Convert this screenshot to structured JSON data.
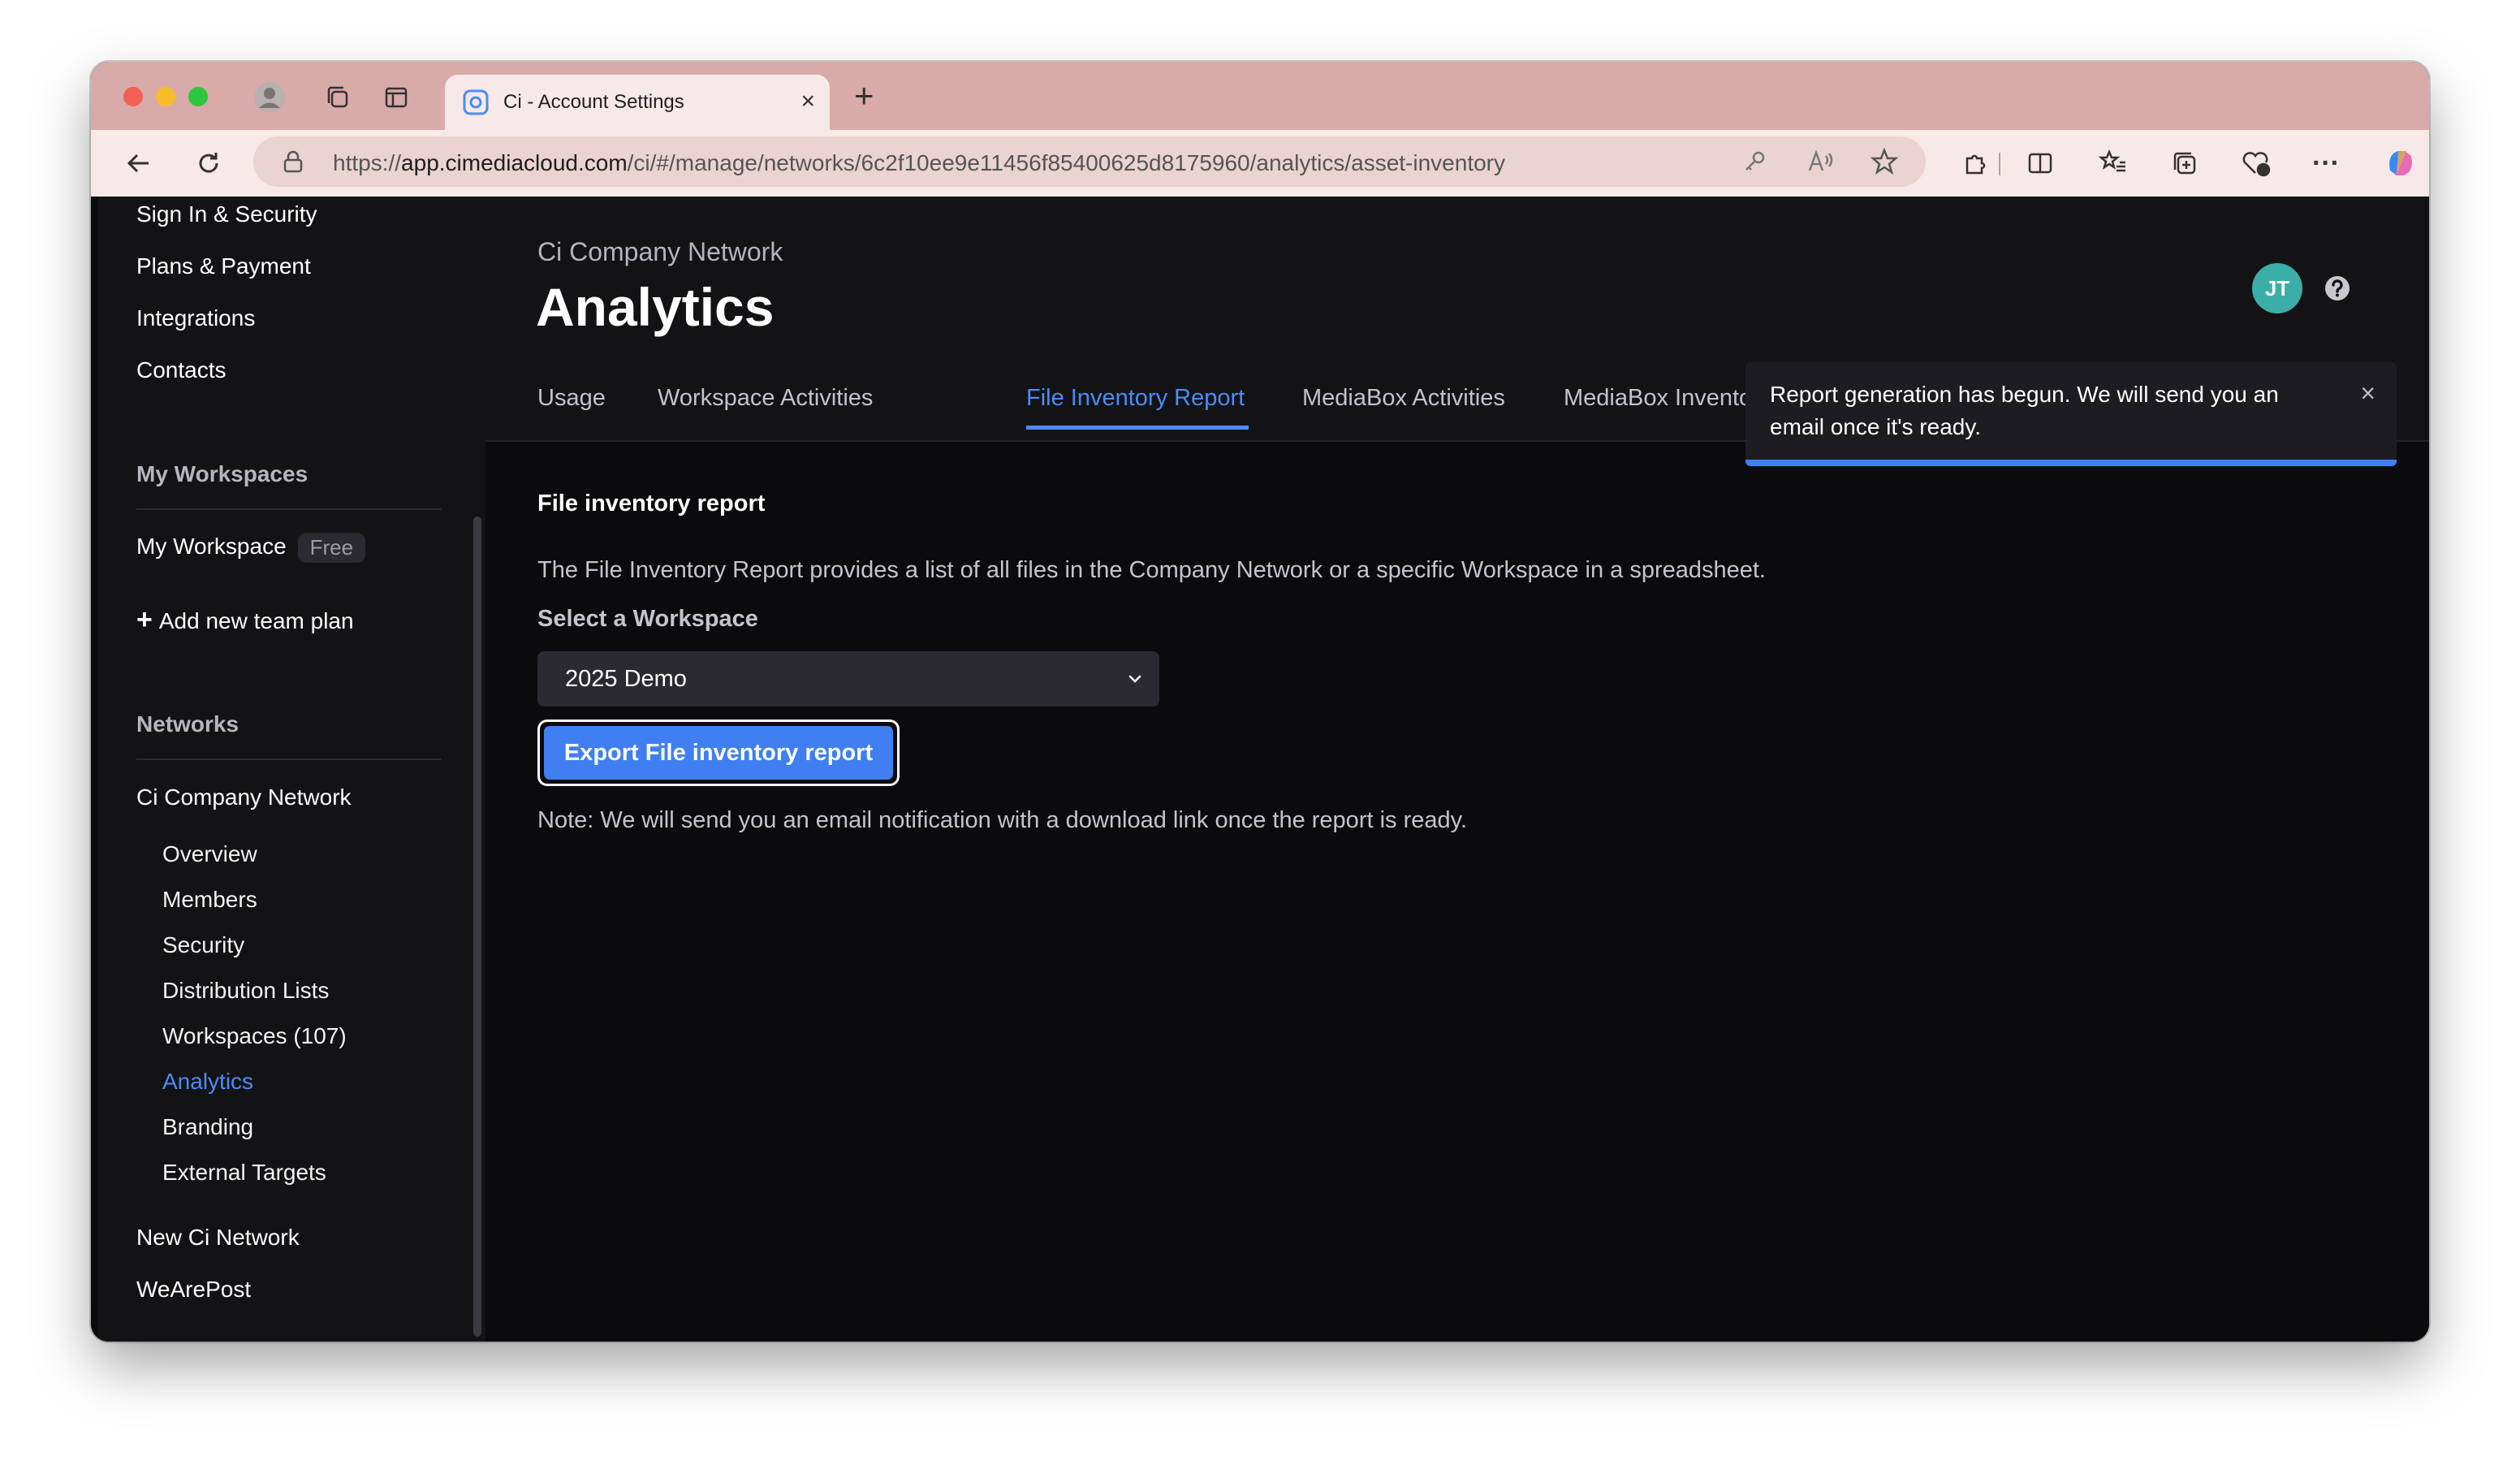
{
  "browser": {
    "tab_title": "Ci - Account Settings",
    "url_prefix": "https://",
    "url_host": "app.cimediacloud.com",
    "url_path": "/ci/#/manage/networks/6c2f10ee9e11456f85400625d8175960/analytics/asset-inventory"
  },
  "sidebar": {
    "account_items": [
      "Sign In & Security",
      "Plans & Payment",
      "Integrations",
      "Contacts"
    ],
    "workspaces_heading": "My Workspaces",
    "my_workspace": {
      "label": "My Workspace",
      "badge": "Free"
    },
    "add_team_plan": "Add new team plan",
    "networks_heading": "Networks",
    "network_name": "Ci Company Network",
    "network_items": [
      "Overview",
      "Members",
      "Security",
      "Distribution Lists",
      "Workspaces (107)",
      "Analytics",
      "Branding",
      "External Targets"
    ],
    "other_networks": [
      "New Ci Network",
      "WeArePost"
    ]
  },
  "header": {
    "subtitle": "Ci Company Network",
    "title": "Analytics",
    "avatar_initials": "JT",
    "tabs": [
      "Usage",
      "Workspace Activities",
      "File Inventory Report",
      "MediaBox Activities",
      "MediaBox Inventory"
    ],
    "active_tab": "File Inventory Report"
  },
  "toast": {
    "message": "Report generation has begun. We will send you an email once it's ready.",
    "close_glyph": "×"
  },
  "content": {
    "title": "File inventory report",
    "description": "The File Inventory Report provides a list of all files in the Company Network or a specific Workspace in a spreadsheet.",
    "select_label": "Select a Workspace",
    "select_value": "2025 Demo",
    "export_button": "Export File inventory report",
    "note": "Note: We will send you an email notification with a download link once the report is ready."
  },
  "colors": {
    "accent": "#4c8bf5",
    "button": "#3f7ff2",
    "avatar": "#3aaea7",
    "page_bg": "#0b0b0d",
    "panel_bg": "#131316"
  }
}
